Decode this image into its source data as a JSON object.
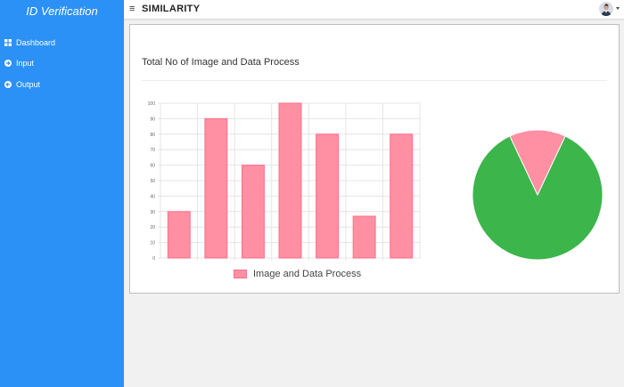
{
  "sidebar": {
    "brand": "ID Verification",
    "items": [
      {
        "label": "Dashboard",
        "icon": "grid-icon"
      },
      {
        "label": "Input",
        "icon": "arrow-circle-right-icon"
      },
      {
        "label": "Output",
        "icon": "arrow-circle-left-icon"
      }
    ]
  },
  "header": {
    "menu_icon": "hamburger-icon",
    "title": "SIMILARITY"
  },
  "card": {
    "title": "Total No of Image and Data Process"
  },
  "colors": {
    "sidebar": "#2b91f7",
    "bar_fill": "#ff8fa3",
    "pie_green": "#3cb54a",
    "pie_pink": "#ff8fa3"
  },
  "chart_data": [
    {
      "type": "bar",
      "categories": [
        "",
        "",
        "",
        "",
        "",
        "",
        ""
      ],
      "series": [
        {
          "name": "Image and Data Process",
          "values": [
            30,
            90,
            60,
            100,
            80,
            27,
            80
          ]
        }
      ],
      "ylim": [
        0,
        100
      ],
      "yticks": [
        0,
        10,
        20,
        30,
        40,
        50,
        60,
        70,
        80,
        90,
        100
      ],
      "grid": true,
      "legend": "bottom"
    },
    {
      "type": "pie",
      "slices": [
        {
          "label": "",
          "value": 86
        },
        {
          "label": "",
          "value": 14
        }
      ]
    }
  ]
}
